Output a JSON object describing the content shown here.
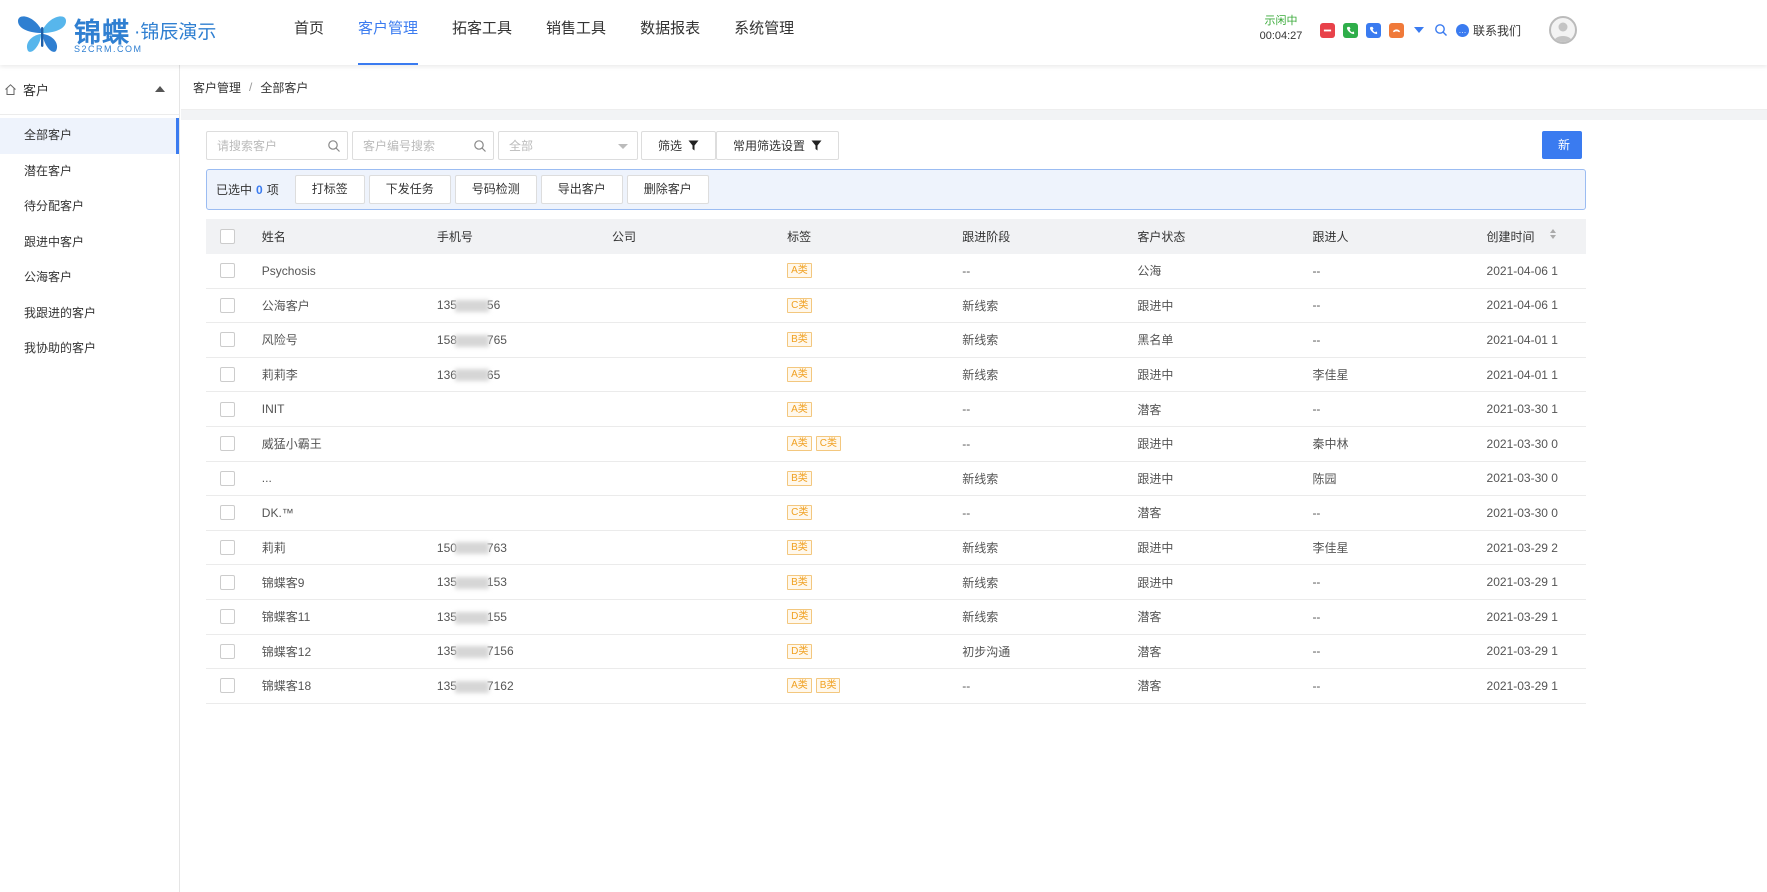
{
  "header": {
    "logo_main": "锦蝶",
    "logo_sub": "·锦辰演示",
    "logo_en": "S2CRM.COM",
    "nav": [
      {
        "label": "首页",
        "active": false
      },
      {
        "label": "客户管理",
        "active": true
      },
      {
        "label": "拓客工具",
        "active": false
      },
      {
        "label": "销售工具",
        "active": false
      },
      {
        "label": "数据报表",
        "active": false
      },
      {
        "label": "系统管理",
        "active": false
      }
    ],
    "status_label": "示闲中",
    "status_time": "00:04:27",
    "contact_label": "联系我们",
    "tool_icons": [
      "hangup-icon",
      "phone-icon",
      "transfer-icon",
      "call-out-icon"
    ]
  },
  "sidebar": {
    "title": "客户",
    "items": [
      {
        "label": "全部客户",
        "active": true
      },
      {
        "label": "潜在客户",
        "active": false
      },
      {
        "label": "待分配客户",
        "active": false
      },
      {
        "label": "跟进中客户",
        "active": false
      },
      {
        "label": "公海客户",
        "active": false
      },
      {
        "label": "我跟进的客户",
        "active": false
      },
      {
        "label": "我协助的客户",
        "active": false
      }
    ]
  },
  "breadcrumb": {
    "parent": "客户管理",
    "current": "全部客户"
  },
  "filters": {
    "search_placeholder": "请搜索客户",
    "code_placeholder": "客户编号搜索",
    "select_value": "全部",
    "filter_label": "筛选",
    "common_filter_label": "常用筛选设置",
    "new_label": "新"
  },
  "selection": {
    "prefix": "已选中",
    "count": "0",
    "suffix": "项",
    "actions": [
      "打标签",
      "下发任务",
      "号码检测",
      "导出客户",
      "删除客户"
    ]
  },
  "table": {
    "columns": [
      "姓名",
      "手机号",
      "公司",
      "标签",
      "跟进阶段",
      "客户状态",
      "跟进人",
      "创建时间"
    ],
    "rows": [
      {
        "name": "Psychosis",
        "phone_a": "",
        "phone_b": "",
        "company": "",
        "tags": [
          "A类"
        ],
        "stage": "--",
        "status": "公海",
        "owner": "--",
        "time": "2021-04-06 1"
      },
      {
        "name": "公海客户",
        "phone_a": "135",
        "phone_b": "56",
        "company": "",
        "tags": [
          "C类"
        ],
        "stage": "新线索",
        "status": "跟进中",
        "owner": "--",
        "time": "2021-04-06 1"
      },
      {
        "name": "风险号",
        "phone_a": "158",
        "phone_b": "765",
        "company": "",
        "tags": [
          "B类"
        ],
        "stage": "新线索",
        "status": "黑名单",
        "owner": "--",
        "time": "2021-04-01 1"
      },
      {
        "name": "莉莉李",
        "phone_a": "136",
        "phone_b": "65",
        "company": "",
        "tags": [
          "A类"
        ],
        "stage": "新线索",
        "status": "跟进中",
        "owner": "李佳星",
        "time": "2021-04-01 1"
      },
      {
        "name": "INIT",
        "phone_a": "",
        "phone_b": "",
        "company": "",
        "tags": [
          "A类"
        ],
        "stage": "--",
        "status": "潜客",
        "owner": "--",
        "time": "2021-03-30 1"
      },
      {
        "name": "威猛小霸王",
        "phone_a": "",
        "phone_b": "",
        "company": "",
        "tags": [
          "A类",
          "C类"
        ],
        "stage": "--",
        "status": "跟进中",
        "owner": "秦中林",
        "time": "2021-03-30 0"
      },
      {
        "name": "...",
        "phone_a": "",
        "phone_b": "",
        "company": "",
        "tags": [
          "B类"
        ],
        "stage": "新线索",
        "status": "跟进中",
        "owner": "陈园",
        "time": "2021-03-30 0"
      },
      {
        "name": "DK.™",
        "phone_a": "",
        "phone_b": "",
        "company": "",
        "tags": [
          "C类"
        ],
        "stage": "--",
        "status": "潜客",
        "owner": "--",
        "time": "2021-03-30 0"
      },
      {
        "name": "莉莉",
        "phone_a": "150",
        "phone_b": "763",
        "company": "",
        "tags": [
          "B类"
        ],
        "stage": "新线索",
        "status": "跟进中",
        "owner": "李佳星",
        "time": "2021-03-29 2"
      },
      {
        "name": "锦蝶客9",
        "phone_a": "135",
        "phone_b": "153",
        "company": "",
        "tags": [
          "B类"
        ],
        "stage": "新线索",
        "status": "跟进中",
        "owner": "--",
        "time": "2021-03-29 1"
      },
      {
        "name": "锦蝶客11",
        "phone_a": "135",
        "phone_b": "155",
        "company": "",
        "tags": [
          "D类"
        ],
        "stage": "新线索",
        "status": "潜客",
        "owner": "--",
        "time": "2021-03-29 1"
      },
      {
        "name": "锦蝶客12",
        "phone_a": "135",
        "phone_b": "7156",
        "company": "",
        "tags": [
          "D类"
        ],
        "stage": "初步沟通",
        "status": "潜客",
        "owner": "--",
        "time": "2021-03-29 1"
      },
      {
        "name": "锦蝶客18",
        "phone_a": "135",
        "phone_b": "7162",
        "company": "",
        "tags": [
          "A类",
          "B类"
        ],
        "stage": "--",
        "status": "潜客",
        "owner": "--",
        "time": "2021-03-29 1"
      }
    ]
  },
  "colors": {
    "accent": "#3a7bf0",
    "tag_border": "#f3c77e",
    "tag_text": "#f0a020",
    "status_idle": "#3aaa3a"
  }
}
